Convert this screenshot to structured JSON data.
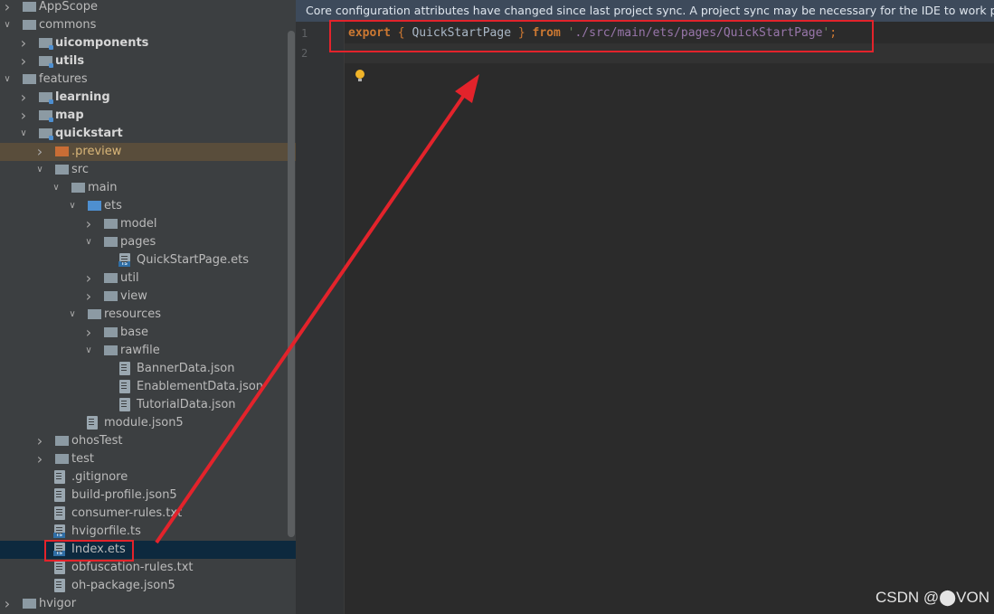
{
  "tree": {
    "items": [
      {
        "label": "AppScope",
        "type": "folder",
        "expand": "closed",
        "indent": 0,
        "style": "normal",
        "color": "gray"
      },
      {
        "label": "commons",
        "type": "folder",
        "expand": "open",
        "indent": 0,
        "style": "normal",
        "color": "gray"
      },
      {
        "label": "uicomponents",
        "type": "module",
        "expand": "closed",
        "indent": 1,
        "style": "bold",
        "color": "gray"
      },
      {
        "label": "utils",
        "type": "module",
        "expand": "closed",
        "indent": 1,
        "style": "bold",
        "color": "gray"
      },
      {
        "label": "features",
        "type": "folder",
        "expand": "open",
        "indent": 0,
        "style": "normal",
        "color": "gray"
      },
      {
        "label": "learning",
        "type": "module",
        "expand": "closed",
        "indent": 1,
        "style": "bold",
        "color": "gray"
      },
      {
        "label": "map",
        "type": "module",
        "expand": "closed",
        "indent": 1,
        "style": "bold",
        "color": "gray"
      },
      {
        "label": "quickstart",
        "type": "module",
        "expand": "open",
        "indent": 1,
        "style": "bold",
        "color": "gray"
      },
      {
        "label": ".preview",
        "type": "folder",
        "expand": "closed",
        "indent": 2,
        "style": "excluded",
        "color": "orange"
      },
      {
        "label": "src",
        "type": "folder",
        "expand": "open",
        "indent": 2,
        "style": "normal",
        "color": "gray"
      },
      {
        "label": "main",
        "type": "folder",
        "expand": "open",
        "indent": 3,
        "style": "normal",
        "color": "gray"
      },
      {
        "label": "ets",
        "type": "folder",
        "expand": "open",
        "indent": 4,
        "style": "normal",
        "color": "blue"
      },
      {
        "label": "model",
        "type": "folder",
        "expand": "closed",
        "indent": 5,
        "style": "normal",
        "color": "gray"
      },
      {
        "label": "pages",
        "type": "folder",
        "expand": "open",
        "indent": 5,
        "style": "normal",
        "color": "gray"
      },
      {
        "label": "QuickStartPage.ets",
        "type": "ets",
        "expand": "none",
        "indent": 6,
        "style": "normal",
        "color": "gray"
      },
      {
        "label": "util",
        "type": "folder",
        "expand": "closed",
        "indent": 5,
        "style": "normal",
        "color": "gray"
      },
      {
        "label": "view",
        "type": "folder",
        "expand": "closed",
        "indent": 5,
        "style": "normal",
        "color": "gray"
      },
      {
        "label": "resources",
        "type": "folder",
        "expand": "open",
        "indent": 4,
        "style": "normal",
        "color": "gray"
      },
      {
        "label": "base",
        "type": "folder",
        "expand": "closed",
        "indent": 5,
        "style": "normal",
        "color": "gray"
      },
      {
        "label": "rawfile",
        "type": "folder",
        "expand": "open",
        "indent": 5,
        "style": "normal",
        "color": "gray"
      },
      {
        "label": "BannerData.json",
        "type": "json",
        "expand": "none",
        "indent": 6,
        "style": "normal",
        "color": "gray"
      },
      {
        "label": "EnablementData.json",
        "type": "json",
        "expand": "none",
        "indent": 6,
        "style": "normal",
        "color": "gray"
      },
      {
        "label": "TutorialData.json",
        "type": "json",
        "expand": "none",
        "indent": 6,
        "style": "normal",
        "color": "gray"
      },
      {
        "label": "module.json5",
        "type": "json",
        "expand": "none",
        "indent": 4,
        "style": "normal",
        "color": "gray"
      },
      {
        "label": "ohosTest",
        "type": "folder",
        "expand": "closed",
        "indent": 2,
        "style": "normal",
        "color": "gray"
      },
      {
        "label": "test",
        "type": "folder",
        "expand": "closed",
        "indent": 2,
        "style": "normal",
        "color": "gray"
      },
      {
        "label": ".gitignore",
        "type": "json",
        "expand": "none",
        "indent": 2,
        "style": "normal",
        "color": "gray"
      },
      {
        "label": "build-profile.json5",
        "type": "json",
        "expand": "none",
        "indent": 2,
        "style": "normal",
        "color": "gray"
      },
      {
        "label": "consumer-rules.txt",
        "type": "txt",
        "expand": "none",
        "indent": 2,
        "style": "normal",
        "color": "gray"
      },
      {
        "label": "hvigorfile.ts",
        "type": "ets",
        "expand": "none",
        "indent": 2,
        "style": "normal",
        "color": "gray"
      },
      {
        "label": "Index.ets",
        "type": "ets",
        "expand": "none",
        "indent": 2,
        "style": "selected",
        "color": "gray"
      },
      {
        "label": "obfuscation-rules.txt",
        "type": "txt",
        "expand": "none",
        "indent": 2,
        "style": "normal",
        "color": "gray"
      },
      {
        "label": "oh-package.json5",
        "type": "json",
        "expand": "none",
        "indent": 2,
        "style": "normal",
        "color": "gray"
      },
      {
        "label": "hvigor",
        "type": "folder",
        "expand": "closed",
        "indent": 0,
        "style": "normal",
        "color": "gray"
      }
    ]
  },
  "editor": {
    "banner": "Core configuration attributes have changed since last project sync. A project sync may be necessary for the IDE to work properly.",
    "line_numbers": [
      "1",
      "2"
    ],
    "code": {
      "kw_export": "export",
      "brace_open": "{",
      "ident": "QuickStartPage",
      "brace_close": "}",
      "kw_from": "from",
      "quote_open": "'",
      "path": "./src/main/ets/pages/QuickStartPage",
      "quote_close": "'",
      "semicolon": ";"
    }
  },
  "watermark": "CSDN @⬤VON",
  "colors": {
    "annotation_red": "#e3232b",
    "tree_bg": "#3c3f41",
    "editor_bg": "#2b2b2b",
    "banner_bg": "#3d4a5b"
  }
}
